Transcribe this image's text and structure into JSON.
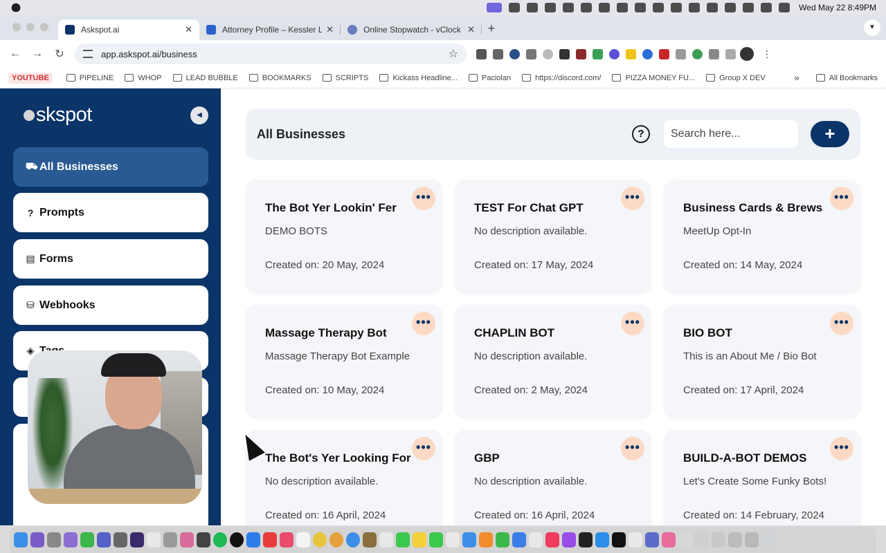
{
  "menubar": {
    "clock": "Wed May 22  8:49PM"
  },
  "tabs": [
    {
      "title": "Askspot.ai",
      "active": true,
      "color": "#0b3468"
    },
    {
      "title": "Attorney Profile – Kessler Law",
      "active": false,
      "color": "#2b62c9"
    },
    {
      "title": "Online Stopwatch - vClock",
      "active": false,
      "color": "#6b7cbf"
    }
  ],
  "toolbar": {
    "url": "app.askspot.ai/business"
  },
  "bookmarks": [
    {
      "label": "YOUTUBE",
      "style": "yt"
    },
    {
      "label": "PIPELINE"
    },
    {
      "label": "WHOP"
    },
    {
      "label": "LEAD BUBBLE"
    },
    {
      "label": "BOOKMARKS"
    },
    {
      "label": "SCRIPTS"
    },
    {
      "label": "Kickass Headline..."
    },
    {
      "label": "Paciolan"
    },
    {
      "label": "https://discord.com/"
    },
    {
      "label": "PIZZA MONEY FU..."
    },
    {
      "label": "Group X DEV"
    }
  ],
  "bookmarks_all": "All Bookmarks",
  "sidebar": {
    "logo": "skspot",
    "items": [
      {
        "label": "All Businesses",
        "icon": "briefcase-icon",
        "glyph": "⛟",
        "active": true
      },
      {
        "label": "Prompts",
        "icon": "question-icon",
        "glyph": "?",
        "active": false
      },
      {
        "label": "Forms",
        "icon": "form-icon",
        "glyph": "▤",
        "active": false
      },
      {
        "label": "Webhooks",
        "icon": "webhook-icon",
        "glyph": "⛁",
        "active": false
      },
      {
        "label": "Tags",
        "icon": "tag-icon",
        "glyph": "◈",
        "active": false
      }
    ]
  },
  "header": {
    "title": "All Businesses",
    "search_placeholder": "Search here...",
    "add_label": "+"
  },
  "cards": [
    {
      "title": "The Bot Yer Lookin' Fer",
      "description": "DEMO BOTS",
      "created": "Created on: 20 May, 2024"
    },
    {
      "title": "TEST For Chat GPT",
      "description": "No description available.",
      "created": "Created on: 17 May, 2024"
    },
    {
      "title": "Business Cards & Brews",
      "description": "MeetUp Opt-In",
      "created": "Created on: 14 May, 2024"
    },
    {
      "title": "Massage Therapy Bot",
      "description": "Massage Therapy Bot Example",
      "created": "Created on: 10 May, 2024"
    },
    {
      "title": "CHAPLIN BOT",
      "description": "No description available.",
      "created": "Created on: 2 May, 2024"
    },
    {
      "title": "BIO BOT",
      "description": "This is an About Me / Bio Bot",
      "created": "Created on: 17 April, 2024"
    },
    {
      "title": "The Bot's Yer Looking For",
      "description": "No description available.",
      "created": "Created on: 16 April, 2024"
    },
    {
      "title": "GBP",
      "description": "No description available.",
      "created": "Created on: 16 April, 2024"
    },
    {
      "title": "BUILD-A-BOT DEMOS",
      "description": "Let's Create Some Funky Bots!",
      "created": "Created on: 14 February, 2024"
    }
  ],
  "card_more_label": "•••",
  "colors": {
    "sidebar": "#0b3468",
    "sidebar_active": "#2a5a93",
    "accent_more": "#fbd9c4"
  }
}
